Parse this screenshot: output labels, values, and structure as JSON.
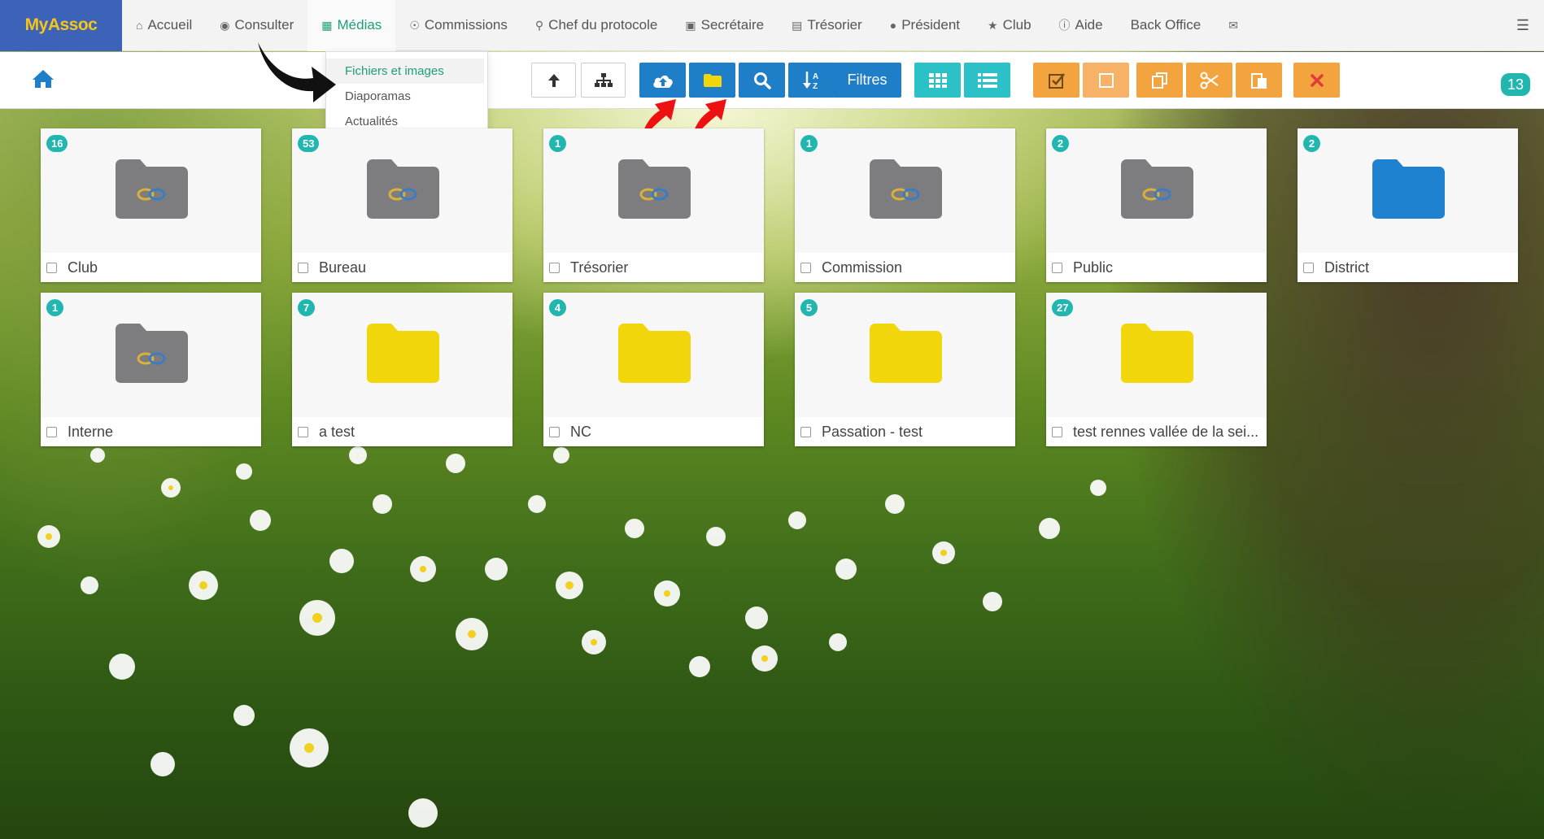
{
  "brand": "MyAssoc",
  "nav": [
    {
      "label": "Accueil",
      "icon": "home-icon",
      "active": false
    },
    {
      "label": "Consulter",
      "icon": "eye-icon",
      "active": false
    },
    {
      "label": "Médias",
      "icon": "file-icon",
      "active": true
    },
    {
      "label": "Commissions",
      "icon": "user-circle-icon",
      "active": false
    },
    {
      "label": "Chef du protocole",
      "icon": "trophy-icon",
      "active": false
    },
    {
      "label": "Secrétaire",
      "icon": "book-icon",
      "active": false
    },
    {
      "label": "Trésorier",
      "icon": "money-icon",
      "active": false
    },
    {
      "label": "Président",
      "icon": "globe-icon",
      "active": false
    },
    {
      "label": "Club",
      "icon": "star-icon",
      "active": false
    },
    {
      "label": "Aide",
      "icon": "info-icon",
      "active": false
    },
    {
      "label": "Back Office",
      "icon": "",
      "active": false
    }
  ],
  "dropdown": {
    "items": [
      {
        "label": "Fichiers et images",
        "active": true
      },
      {
        "label": "Diaporamas",
        "active": false
      },
      {
        "label": "Actualités",
        "active": false
      }
    ]
  },
  "toolbar": {
    "filters_label": "Filtres",
    "count": "13"
  },
  "colors": {
    "brand_bg": "#3d63b8",
    "brand_text": "#f5c518",
    "accent": "#1f9d7a",
    "blue_button": "#1e7ec8",
    "teal_button": "#2cc1c6",
    "orange_button": "#f3a43e",
    "badge": "#22b6b0",
    "folder_gray": "#7d7d80",
    "folder_blue": "#1e82d0",
    "folder_yellow": "#f2d60c"
  },
  "folders": [
    {
      "name": "Club",
      "count": "16",
      "type": "linked"
    },
    {
      "name": "Bureau",
      "count": "53",
      "type": "linked"
    },
    {
      "name": "Trésorier",
      "count": "1",
      "type": "linked"
    },
    {
      "name": "Commission",
      "count": "1",
      "type": "linked"
    },
    {
      "name": "Public",
      "count": "2",
      "type": "linked"
    },
    {
      "name": "District",
      "count": "2",
      "type": "blue"
    },
    {
      "name": "Interne",
      "count": "1",
      "type": "linked"
    },
    {
      "name": "a test",
      "count": "7",
      "type": "yellow"
    },
    {
      "name": "NC",
      "count": "4",
      "type": "yellow"
    },
    {
      "name": "Passation - test",
      "count": "5",
      "type": "yellow"
    },
    {
      "name": "test rennes vallée de la sei...",
      "count": "27",
      "type": "yellow"
    }
  ]
}
